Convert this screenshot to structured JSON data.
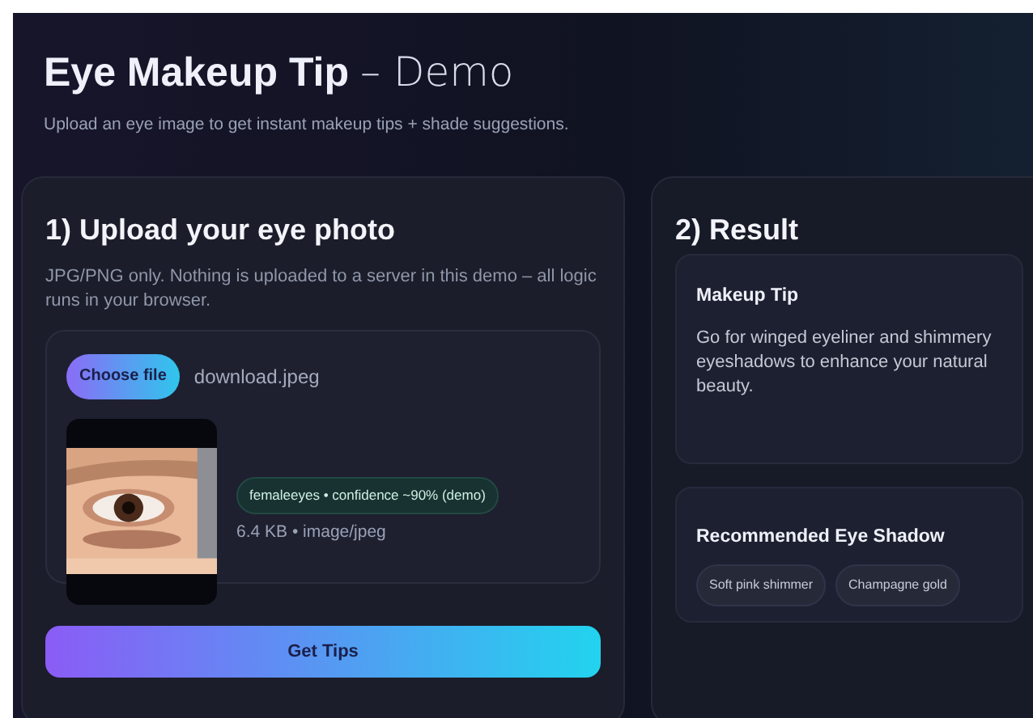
{
  "header": {
    "title": "Eye Makeup Tip",
    "title_suffix": "– Demo",
    "subtitle": "Upload an eye image to get instant makeup tips + shade suggestions."
  },
  "upload": {
    "heading": "1) Upload your eye photo",
    "note": "JPG/PNG only. Nothing is uploaded to a server in this demo – all logic runs in your browser.",
    "choose_button": "Choose file",
    "file_name": "download.jpeg",
    "badge": "femaleeyes • confidence ~90% (demo)",
    "file_info": "6.4 KB • image/jpeg",
    "submit_button": "Get Tips"
  },
  "result": {
    "heading": "2) Result",
    "tip": {
      "title": "Makeup Tip",
      "text": "Go for winged eyeliner and shimmery eyeshadows to enhance your natural beauty."
    },
    "shadow": {
      "title": "Recommended Eye Shadow",
      "chips": [
        "Soft pink shimmer",
        "Champagne gold"
      ]
    }
  }
}
